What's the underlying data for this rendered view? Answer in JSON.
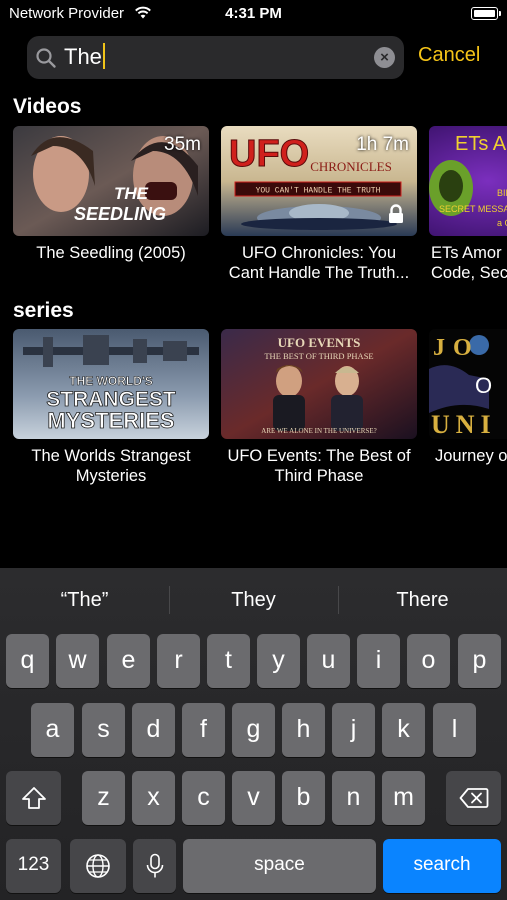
{
  "status_bar": {
    "carrier": "Network Provider",
    "time": "4:31 PM"
  },
  "search": {
    "query": "The",
    "cancel_label": "Cancel"
  },
  "sections": [
    {
      "title": "Videos",
      "items": [
        {
          "title": "The Seedling (2005)",
          "duration": "35m",
          "locked": false,
          "thumb_text": [
            "THE",
            "SEEDLING"
          ]
        },
        {
          "title_line1": "UFO Chronicles: You",
          "title_line2": "Cant Handle The Truth...",
          "duration": "1h 7m",
          "locked": true,
          "thumb_text": [
            "UFO",
            "CHRONICLES",
            "YOU CAN'T HANDLE THE TRUTH"
          ]
        },
        {
          "title_line1": "ETs Amor",
          "title_line2": "Code, Sec",
          "thumb_text": [
            "ETs AN",
            "BIN",
            "SECRET MESSA",
            "a C"
          ]
        }
      ]
    },
    {
      "title": "series",
      "items": [
        {
          "title_line1": "The Worlds Strangest",
          "title_line2": "Mysteries",
          "thumb_text": [
            "THE WORLD'S",
            "STRANGEST",
            "MYSTERIES"
          ]
        },
        {
          "title_line1": "UFO Events: The Best of",
          "title_line2": "Third Phase",
          "thumb_text": [
            "UFO EVENTS",
            "THE BEST OF THIRD PHASE",
            "ARE WE ALONE IN THE UNIVERSE?"
          ]
        },
        {
          "title_line1": "Journey o",
          "thumb_text": [
            "JO",
            "O",
            "UNI"
          ]
        }
      ]
    }
  ],
  "keyboard": {
    "suggestions": [
      "“The”",
      "They",
      "There"
    ],
    "row1": [
      "q",
      "w",
      "e",
      "r",
      "t",
      "y",
      "u",
      "i",
      "o",
      "p"
    ],
    "row2": [
      "a",
      "s",
      "d",
      "f",
      "g",
      "h",
      "j",
      "k",
      "l"
    ],
    "row3": [
      "z",
      "x",
      "c",
      "v",
      "b",
      "n",
      "m"
    ],
    "numbers_label": "123",
    "space_label": "space",
    "search_label": "search"
  },
  "colors": {
    "accent": "#f5c418",
    "search_key": "#0a84ff"
  }
}
